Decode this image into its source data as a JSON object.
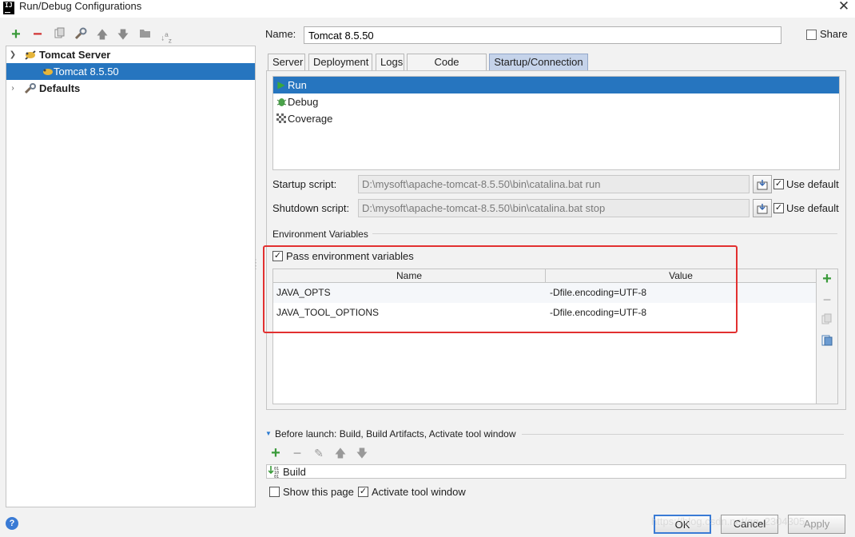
{
  "window": {
    "title": "Run/Debug Configurations",
    "app_icon_text": "IJ"
  },
  "toolbar": {
    "add_icon": "plus-icon",
    "remove_icon": "minus-icon",
    "copy_icon": "copy-icon",
    "edit_defaults_icon": "wrench-icon",
    "move_up_icon": "arrow-up-icon",
    "move_down_icon": "arrow-down-icon",
    "folder_icon": "folder-icon",
    "sort_icon": "sort-az-icon"
  },
  "tree": {
    "items": [
      {
        "label": "Tomcat Server",
        "expanded": true,
        "level": 0
      },
      {
        "label": "Tomcat 8.5.50",
        "selected": true,
        "level": 1
      },
      {
        "label": "Defaults",
        "expanded": false,
        "level": 0
      }
    ]
  },
  "name_field": {
    "label": "Name:",
    "value": "Tomcat 8.5.50"
  },
  "share": {
    "label": "Share",
    "checked": false
  },
  "tabs": [
    {
      "label": "Server",
      "active": false
    },
    {
      "label": "Deployment",
      "active": false
    },
    {
      "label": "Logs",
      "active": false
    },
    {
      "label": "Code Coverage",
      "active": false
    },
    {
      "label": "Startup/Connection",
      "active": true
    }
  ],
  "modes": [
    {
      "label": "Run",
      "icon": "run-icon",
      "selected": true
    },
    {
      "label": "Debug",
      "icon": "debug-icon",
      "selected": false
    },
    {
      "label": "Coverage",
      "icon": "coverage-icon",
      "selected": false
    }
  ],
  "startup_script": {
    "label": "Startup script:",
    "value": "D:\\mysoft\\apache-tomcat-8.5.50\\bin\\catalina.bat run",
    "use_default_label": "Use default",
    "use_default": true
  },
  "shutdown_script": {
    "label": "Shutdown script:",
    "value": "D:\\mysoft\\apache-tomcat-8.5.50\\bin\\catalina.bat stop",
    "use_default_label": "Use default",
    "use_default": true
  },
  "env": {
    "section_title": "Environment Variables",
    "pass_label": "Pass environment variables",
    "pass_checked": true,
    "columns": [
      "Name",
      "Value"
    ],
    "rows": [
      {
        "name": "JAVA_OPTS",
        "value": "-Dfile.encoding=UTF-8"
      },
      {
        "name": "JAVA_TOOL_OPTIONS",
        "value": "-Dfile.encoding=UTF-8"
      }
    ],
    "highlight_color": "#e23030"
  },
  "before_launch": {
    "title": "Before launch: Build, Build Artifacts, Activate tool window",
    "items": [
      "Build"
    ],
    "show_page_label": "Show this page",
    "show_page_checked": false,
    "activate_label": "Activate tool window",
    "activate_checked": true
  },
  "buttons": {
    "ok": "OK",
    "cancel": "Cancel",
    "apply": "Apply"
  },
  "watermark": "https://blog.csdn.net/qq_2304305",
  "colors": {
    "selection": "#2675bf",
    "active_tab": "#c5d3ea",
    "add_green": "#3a9a3a",
    "remove_red": "#d03030"
  }
}
